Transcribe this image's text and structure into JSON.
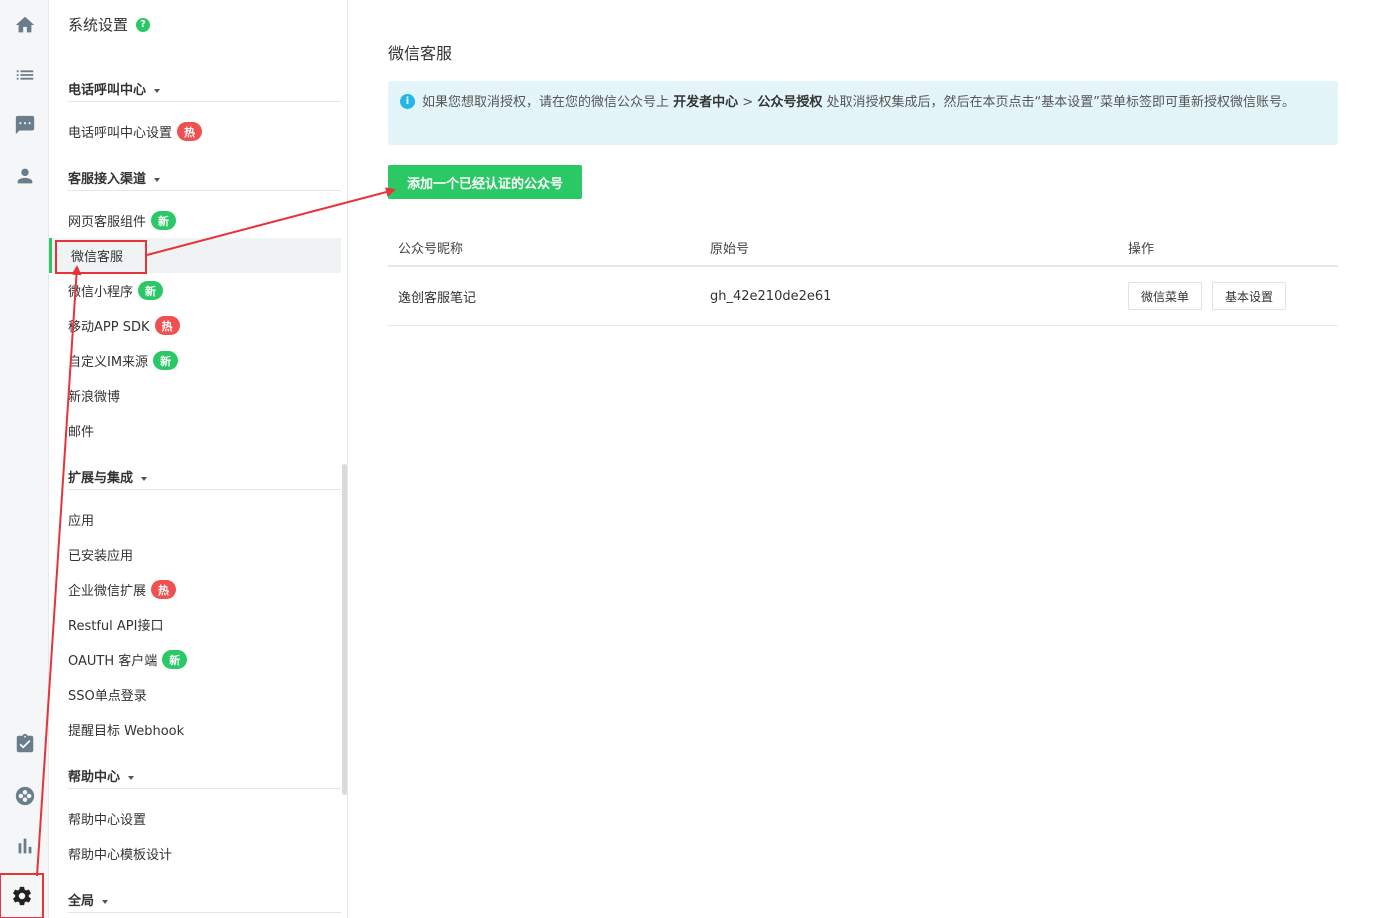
{
  "rail": {
    "items": [
      {
        "icon": "home-icon"
      },
      {
        "icon": "list-icon"
      },
      {
        "icon": "chat-icon"
      },
      {
        "icon": "user-icon"
      },
      {
        "icon": "task-icon"
      },
      {
        "icon": "lifebuoy-icon"
      },
      {
        "icon": "bar-chart-icon"
      },
      {
        "icon": "gear-icon"
      }
    ]
  },
  "menu": {
    "title": "系统设置",
    "help": "?",
    "groups": [
      {
        "label": "电话呼叫中心",
        "items": [
          {
            "label": "电话呼叫中心设置",
            "badge": "热"
          }
        ]
      },
      {
        "label": "客服接入渠道",
        "items": [
          {
            "label": "网页客服组件",
            "badge": "新"
          },
          {
            "label": "微信客服",
            "active": true
          },
          {
            "label": "微信小程序",
            "badge": "新"
          },
          {
            "label": "移动APP SDK",
            "badge": "热"
          },
          {
            "label": "自定义IM来源",
            "badge": "新"
          },
          {
            "label": "新浪微博"
          },
          {
            "label": "邮件"
          }
        ]
      },
      {
        "label": "扩展与集成",
        "items": [
          {
            "label": "应用"
          },
          {
            "label": "已安装应用"
          },
          {
            "label": "企业微信扩展",
            "badge": "热"
          },
          {
            "label": "Restful API接口"
          },
          {
            "label": "OAUTH 客户端",
            "badge": "新"
          },
          {
            "label": "SSO单点登录"
          },
          {
            "label": "提醒目标 Webhook"
          }
        ]
      },
      {
        "label": "帮助中心",
        "items": [
          {
            "label": "帮助中心设置"
          },
          {
            "label": "帮助中心模板设计"
          }
        ]
      },
      {
        "label": "全局",
        "items": []
      }
    ]
  },
  "main": {
    "title": "微信客服",
    "alert": {
      "icon": "i",
      "text_pre": "如果您想取消授权，请在您的微信公众号上 ",
      "bold1": "开发者中心",
      "sep": " > ",
      "bold2": "公众号授权",
      "text_post": " 处取消授权集成后，然后在本页点击“基本设置”菜单标签即可重新授权微信账号。"
    },
    "add_button": "添加一个已经认证的公众号",
    "table": {
      "headers": [
        "公众号昵称",
        "原始号",
        "操作"
      ],
      "rows": [
        {
          "name": "逸创客服笔记",
          "id": "gh_42e210de2e61",
          "actions": [
            "微信菜单",
            "基本设置"
          ]
        }
      ]
    }
  },
  "colors": {
    "accent": "#2bc866",
    "hot": "#f05050",
    "annotation": "#e8333a",
    "alert_bg": "#e4f5fa"
  }
}
